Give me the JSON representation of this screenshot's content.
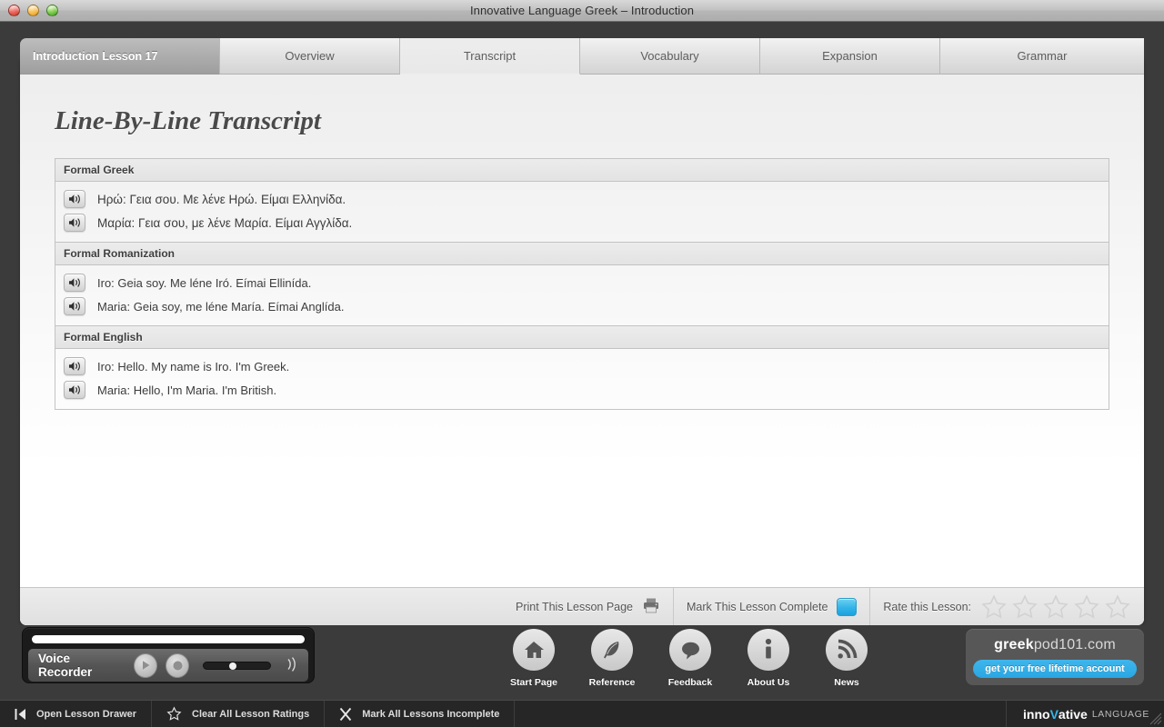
{
  "window": {
    "title": "Innovative Language Greek – Introduction",
    "traffic_lights": [
      "close-button",
      "minimize-button",
      "zoom-button"
    ]
  },
  "tabs": [
    {
      "label": "Introduction Lesson 17",
      "active": false,
      "lesson": true
    },
    {
      "label": "Overview",
      "active": false
    },
    {
      "label": "Transcript",
      "active": true
    },
    {
      "label": "Vocabulary",
      "active": false
    },
    {
      "label": "Expansion",
      "active": false
    },
    {
      "label": "Grammar",
      "active": false
    }
  ],
  "page": {
    "title": "Line-By-Line Transcript"
  },
  "transcript": {
    "sections": [
      {
        "heading": "Formal Greek",
        "lines": [
          "Ηρώ: Γεια σου. Με λένε Ηρώ. Είμαι Ελληνίδα.",
          "Μαρία: Γεια σου, με λένε Μαρία. Είμαι Αγγλίδα."
        ]
      },
      {
        "heading": "Formal Romanization",
        "lines": [
          "Iro: Geia soy. Me léne Iró. Eímai Ellinída.",
          "Maria: Geia soy, me léne María. Eímai Anglída."
        ]
      },
      {
        "heading": "Formal English",
        "lines": [
          "Iro: Hello. My name is Iro. I'm Greek.",
          "Maria: Hello, I'm Maria. I'm British."
        ]
      }
    ],
    "play_icon": "speaker-icon"
  },
  "panel_footer": {
    "print_label": "Print This Lesson Page",
    "print_icon": "printer-icon",
    "complete_label": "Mark This Lesson Complete",
    "complete_checkbox_color": "#2ab0e6",
    "rate_label": "Rate this Lesson:",
    "rating_value": 0,
    "rating_max": 5
  },
  "recorder": {
    "label": "Voice Recorder",
    "play_icon": "play-icon",
    "record_icon": "record-icon",
    "volume_icon": "speaker-wave-icon",
    "volume_percent": 38,
    "progress_percent": 100
  },
  "nav": [
    {
      "label": "Start Page",
      "icon": "home-icon"
    },
    {
      "label": "Reference",
      "icon": "feather-icon"
    },
    {
      "label": "Feedback",
      "icon": "speech-bubble-icon"
    },
    {
      "label": "About Us",
      "icon": "info-icon"
    },
    {
      "label": "News",
      "icon": "rss-icon"
    }
  ],
  "promo": {
    "brand_bold": "greek",
    "brand_rest": "pod101.com",
    "button_label": "get your free lifetime account",
    "accent_color": "#29a6e2"
  },
  "statusbar": {
    "items": [
      {
        "label": "Open Lesson Drawer",
        "icon": "drawer-open-icon"
      },
      {
        "label": "Clear All Lesson Ratings",
        "icon": "star-outline-icon"
      },
      {
        "label": "Mark All Lessons Incomplete",
        "icon": "x-mark-icon"
      }
    ],
    "logo": {
      "part1": "inno",
      "vee": "V",
      "part2": "ative",
      "suffix": "LANGUAGE"
    }
  }
}
